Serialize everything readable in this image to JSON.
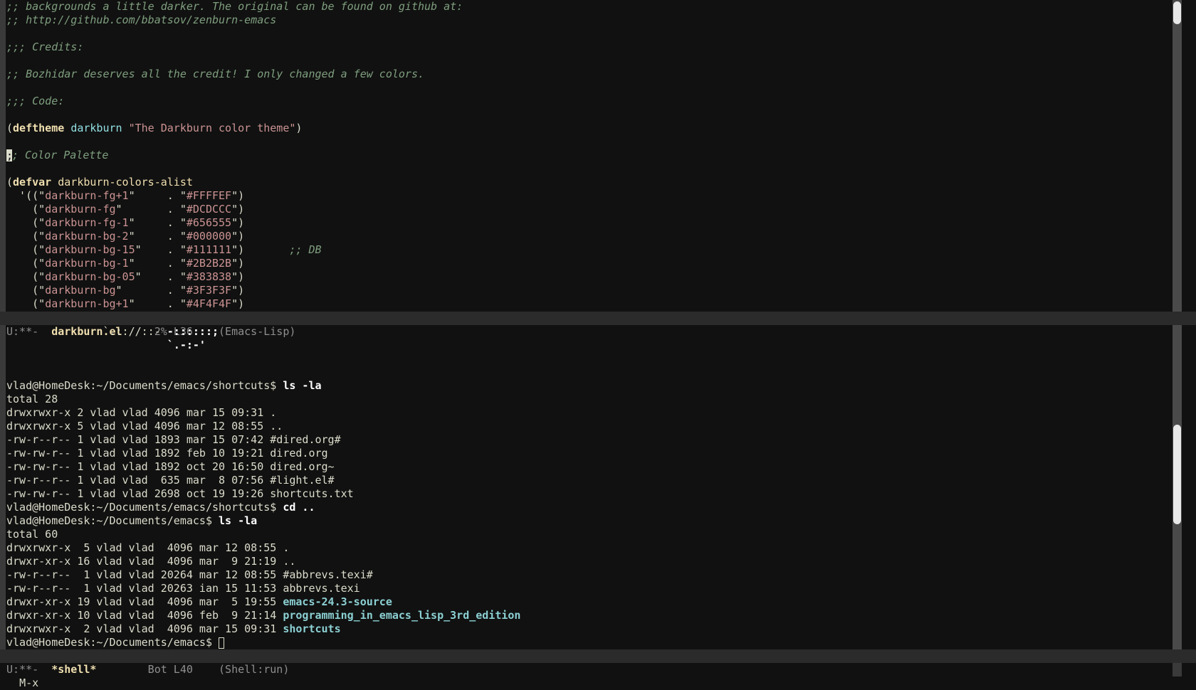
{
  "top_pane": {
    "lines": [
      {
        "segments": [
          {
            "t": ";; backgrounds a little darker. The original can be found on github at:",
            "c": "c-comment"
          }
        ]
      },
      {
        "segments": [
          {
            "t": ";; http://github.com/bbatsov/zenburn-emacs",
            "c": "c-comment"
          }
        ]
      },
      {
        "segments": []
      },
      {
        "segments": [
          {
            "t": ";;; Credits:",
            "c": "c-comment"
          }
        ]
      },
      {
        "segments": []
      },
      {
        "segments": [
          {
            "t": ";; Bozhidar deserves all the credit! I only changed a few colors.",
            "c": "c-comment"
          }
        ]
      },
      {
        "segments": []
      },
      {
        "segments": [
          {
            "t": ";;; Code:",
            "c": "c-comment"
          }
        ]
      },
      {
        "segments": []
      },
      {
        "segments": [
          {
            "t": "("
          },
          {
            "t": "deftheme",
            "c": "c-kw"
          },
          {
            "t": " "
          },
          {
            "t": "darkburn",
            "c": "c-fn"
          },
          {
            "t": " "
          },
          {
            "t": "\"The Darkburn color theme\"",
            "c": "c-str"
          },
          {
            "t": ")"
          }
        ]
      },
      {
        "segments": []
      },
      {
        "segments": [
          {
            "t": ";",
            "c": "cursor"
          },
          {
            "t": "; Color Palette",
            "c": "c-comment"
          }
        ]
      },
      {
        "segments": []
      },
      {
        "segments": [
          {
            "t": "("
          },
          {
            "t": "defvar",
            "c": "c-kw"
          },
          {
            "t": " "
          },
          {
            "t": "darkburn-colors-alist",
            "c": "c-var"
          }
        ]
      },
      {
        "segments": [
          {
            "t": "  '((\""
          },
          {
            "t": "darkburn-fg+1",
            "c": "c-str"
          },
          {
            "t": "\"     . \""
          },
          {
            "t": "#FFFFEF",
            "c": "c-str"
          },
          {
            "t": "\")"
          }
        ]
      },
      {
        "segments": [
          {
            "t": "    (\""
          },
          {
            "t": "darkburn-fg",
            "c": "c-str"
          },
          {
            "t": "\"       . \""
          },
          {
            "t": "#DCDCCC",
            "c": "c-str"
          },
          {
            "t": "\")"
          }
        ]
      },
      {
        "segments": [
          {
            "t": "    (\""
          },
          {
            "t": "darkburn-fg-1",
            "c": "c-str"
          },
          {
            "t": "\"     . \""
          },
          {
            "t": "#656555",
            "c": "c-str"
          },
          {
            "t": "\")"
          }
        ]
      },
      {
        "segments": [
          {
            "t": "    (\""
          },
          {
            "t": "darkburn-bg-2",
            "c": "c-str"
          },
          {
            "t": "\"     . \""
          },
          {
            "t": "#000000",
            "c": "c-str"
          },
          {
            "t": "\")"
          }
        ]
      },
      {
        "segments": [
          {
            "t": "    (\""
          },
          {
            "t": "darkburn-bg-15",
            "c": "c-str"
          },
          {
            "t": "\"    . \""
          },
          {
            "t": "#111111",
            "c": "c-str"
          },
          {
            "t": "\")       "
          },
          {
            "t": ";; DB",
            "c": "c-comment"
          }
        ]
      },
      {
        "segments": [
          {
            "t": "    (\""
          },
          {
            "t": "darkburn-bg-1",
            "c": "c-str"
          },
          {
            "t": "\"     . \""
          },
          {
            "t": "#2B2B2B",
            "c": "c-str"
          },
          {
            "t": "\")"
          }
        ]
      },
      {
        "segments": [
          {
            "t": "    (\""
          },
          {
            "t": "darkburn-bg-05",
            "c": "c-str"
          },
          {
            "t": "\"    . \""
          },
          {
            "t": "#383838",
            "c": "c-str"
          },
          {
            "t": "\")"
          }
        ]
      },
      {
        "segments": [
          {
            "t": "    (\""
          },
          {
            "t": "darkburn-bg",
            "c": "c-str"
          },
          {
            "t": "\"       . \""
          },
          {
            "t": "#3F3F3F",
            "c": "c-str"
          },
          {
            "t": "\")"
          }
        ]
      },
      {
        "segments": [
          {
            "t": "    (\""
          },
          {
            "t": "darkburn-bg+1",
            "c": "c-str"
          },
          {
            "t": "\"     . \""
          },
          {
            "t": "#4F4F4F",
            "c": "c-str"
          },
          {
            "t": "\")"
          }
        ]
      }
    ]
  },
  "top_modeline": {
    "status": "U:**-  ",
    "buffer": "darkburn.el",
    "position": "     2% L36    ",
    "mode": "(Emacs-Lisp)"
  },
  "bottom_pane": {
    "lines": [
      {
        "segments": [
          {
            "t": "               `.:://::- "
          },
          {
            "t": "-::::::;",
            "c": "c-cmd"
          }
        ]
      },
      {
        "segments": [
          {
            "t": "                         "
          },
          {
            "t": "`.-:-'",
            "c": "c-cmd"
          }
        ]
      },
      {
        "segments": []
      },
      {
        "segments": []
      },
      {
        "segments": [
          {
            "t": "vlad@HomeDesk:~/Documents/emacs/shortcuts$ ",
            "c": "c-prompt"
          },
          {
            "t": "ls -la",
            "c": "c-cmd"
          }
        ]
      },
      {
        "segments": [
          {
            "t": "total 28"
          }
        ]
      },
      {
        "segments": [
          {
            "t": "drwxrwxr-x 2 vlad vlad 4096 mar 15 09:31 ."
          }
        ]
      },
      {
        "segments": [
          {
            "t": "drwxrwxr-x 5 vlad vlad 4096 mar 12 08:55 .."
          }
        ]
      },
      {
        "segments": [
          {
            "t": "-rw-r--r-- 1 vlad vlad 1893 mar 15 07:42 #dired.org#"
          }
        ]
      },
      {
        "segments": [
          {
            "t": "-rw-rw-r-- 1 vlad vlad 1892 feb 10 19:21 dired.org"
          }
        ]
      },
      {
        "segments": [
          {
            "t": "-rw-rw-r-- 1 vlad vlad 1892 oct 20 16:50 dired.org~"
          }
        ]
      },
      {
        "segments": [
          {
            "t": "-rw-r--r-- 1 vlad vlad  635 mar  8 07:56 #light.el#"
          }
        ]
      },
      {
        "segments": [
          {
            "t": "-rw-rw-r-- 1 vlad vlad 2698 oct 19 19:26 shortcuts.txt"
          }
        ]
      },
      {
        "segments": [
          {
            "t": "vlad@HomeDesk:~/Documents/emacs/shortcuts$ ",
            "c": "c-prompt"
          },
          {
            "t": "cd ..",
            "c": "c-cmd"
          }
        ]
      },
      {
        "segments": [
          {
            "t": "vlad@HomeDesk:~/Documents/emacs$ ",
            "c": "c-prompt"
          },
          {
            "t": "ls -la",
            "c": "c-cmd"
          }
        ]
      },
      {
        "segments": [
          {
            "t": "total 60"
          }
        ]
      },
      {
        "segments": [
          {
            "t": "drwxrwxr-x  5 vlad vlad  4096 mar 12 08:55 ."
          }
        ]
      },
      {
        "segments": [
          {
            "t": "drwxr-xr-x 16 vlad vlad  4096 mar  9 21:19 .."
          }
        ]
      },
      {
        "segments": [
          {
            "t": "-rw-r--r--  1 vlad vlad 20264 mar 12 08:55 #abbrevs.texi#"
          }
        ]
      },
      {
        "segments": [
          {
            "t": "-rw-r--r--  1 vlad vlad 20263 ian 15 11:53 abbrevs.texi"
          }
        ]
      },
      {
        "segments": [
          {
            "t": "drwxr-xr-x 19 vlad vlad  4096 mar  5 19:55 "
          },
          {
            "t": "emacs-24.3-source",
            "c": "c-dir"
          }
        ]
      },
      {
        "segments": [
          {
            "t": "drwxr-xr-x 10 vlad vlad  4096 feb  9 21:14 "
          },
          {
            "t": "programming_in_emacs_lisp_3rd_edition",
            "c": "c-dir"
          }
        ]
      },
      {
        "segments": [
          {
            "t": "drwxrwxr-x  2 vlad vlad  4096 mar 15 09:31 "
          },
          {
            "t": "shortcuts",
            "c": "c-dir"
          }
        ]
      },
      {
        "segments": [
          {
            "t": "vlad@HomeDesk:~/Documents/emacs$ ",
            "c": "c-prompt"
          },
          {
            "t": " ",
            "c": "cursor-box"
          }
        ]
      }
    ]
  },
  "bottom_modeline": {
    "status": "U:**-  ",
    "buffer": "*shell*",
    "position": "        Bot L40    ",
    "mode": "(Shell:run)"
  },
  "minibuffer": {
    "text": "M-x"
  },
  "colors": {
    "background": "#111111",
    "foreground": "#DCDCCC",
    "comment": "#7F9F7F",
    "keyword": "#F0DFAF",
    "string": "#CC9393",
    "function": "#93E0E3",
    "directory": "#8CD0D3",
    "modeline_bg": "#2B2B2B"
  }
}
